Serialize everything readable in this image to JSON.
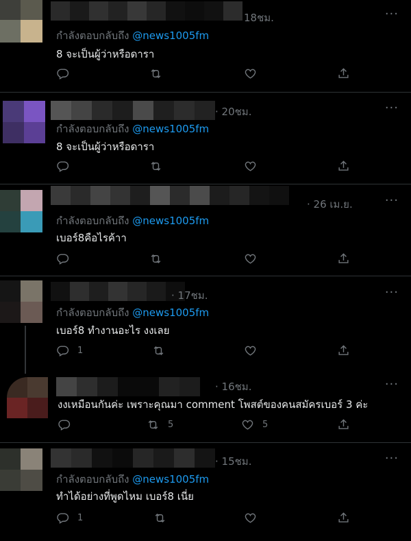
{
  "tweets": [
    {
      "time": "18ชม.",
      "reply_prefix": "กำลังตอบกลับถึง",
      "handle": "@news1005fm",
      "text": "8 จะเป็นผู้ว่าหรือดารา",
      "replies": "",
      "retweets": "",
      "likes": ""
    },
    {
      "time": "· 20ชม.",
      "reply_prefix": "กำลังตอบกลับถึง",
      "handle": "@news1005fm",
      "text": "8 จะเป็นผู้ว่าหรือดารา",
      "replies": "",
      "retweets": "",
      "likes": ""
    },
    {
      "time": "· 26 เม.ย.",
      "reply_prefix": "กำลังตอบกลับถึง",
      "handle": "@news1005fm",
      "text": "เบอร์8คือไรค้าา",
      "replies": "",
      "retweets": "",
      "likes": ""
    },
    {
      "time": "· 17ชม.",
      "reply_prefix": "กำลังตอบกลับถึง",
      "handle": "@news1005fm",
      "text": "เบอร์8 ทำงานอะไร งงเลย",
      "replies": "1",
      "retweets": "",
      "likes": ""
    },
    {
      "time": "· 16ชม.",
      "reply_prefix": "",
      "handle": "",
      "text": "งงเหมือนกันค่ะ เพราะคุณมา comment โพสต์ของคนสมัครเบอร์ 3 ค่ะ",
      "replies": "",
      "retweets": "5",
      "likes": "5"
    },
    {
      "time": "· 15ชม.",
      "reply_prefix": "กำลังตอบกลับถึง",
      "handle": "@news1005fm",
      "text": "ทำได้อย่างที่พูดไหม เบอร์8 เนี่ย",
      "replies": "1",
      "retweets": "",
      "likes": ""
    }
  ],
  "more_label": "···",
  "icons": [
    "reply-icon",
    "retweet-icon",
    "like-icon",
    "share-icon"
  ],
  "colors": {
    "background": "#000000",
    "text": "#e7e9ea",
    "muted": "#71767b",
    "link": "#1d9bf0",
    "divider": "#2f3336"
  }
}
